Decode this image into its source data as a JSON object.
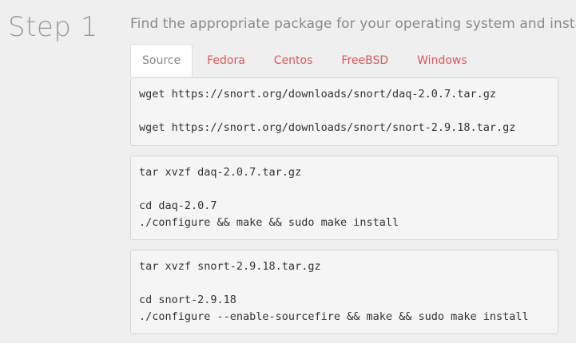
{
  "step": {
    "title": "Step 1",
    "instructions": "Find the appropriate package for your operating system and install."
  },
  "tabs": [
    {
      "label": "Source",
      "active": true
    },
    {
      "label": "Fedora",
      "active": false
    },
    {
      "label": "Centos",
      "active": false
    },
    {
      "label": "FreeBSD",
      "active": false
    },
    {
      "label": "Windows",
      "active": false
    }
  ],
  "code_blocks": [
    {
      "lines": [
        "wget https://snort.org/downloads/snort/daq-2.0.7.tar.gz",
        "",
        "wget https://snort.org/downloads/snort/snort-2.9.18.tar.gz"
      ]
    },
    {
      "lines": [
        "tar xvzf daq-2.0.7.tar.gz",
        "",
        "cd daq-2.0.7",
        "./configure && make && sudo make install"
      ]
    },
    {
      "lines": [
        "tar xvzf snort-2.9.18.tar.gz",
        "",
        "cd snort-2.9.18",
        "./configure --enable-sourcefire && make && sudo make install"
      ]
    }
  ],
  "colors": {
    "tab_link": "#e05555",
    "tab_active_text": "#888888",
    "heading": "#9a9a9a",
    "code_background": "#f5f5f5"
  }
}
